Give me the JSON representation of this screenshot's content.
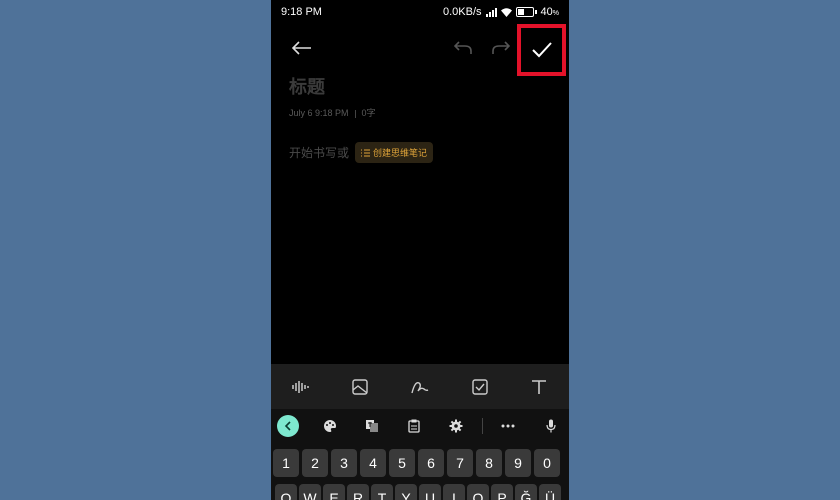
{
  "status": {
    "time": "9:18 PM",
    "network_speed": "0.0KB/s",
    "battery_percent": "40",
    "battery_unit": "%"
  },
  "editor": {
    "title_placeholder": "标题",
    "date": "July 6 9:18 PM",
    "word_count": "0字",
    "body_placeholder": "开始书写或",
    "mindmap_button": "创建思维笔记"
  },
  "toolbar_icons": [
    "back-arrow",
    "undo",
    "redo",
    "checkmark"
  ],
  "format_icons": [
    "voice-wave",
    "image",
    "handwriting",
    "checkbox",
    "text-format"
  ],
  "keyboard": {
    "number_row": [
      "1",
      "2",
      "3",
      "4",
      "5",
      "6",
      "7",
      "8",
      "9",
      "0"
    ],
    "letter_row": [
      "Q",
      "W",
      "E",
      "R",
      "T",
      "Y",
      "U",
      "I",
      "O",
      "P",
      "Ğ",
      "Ü"
    ],
    "tool_icons": [
      "collapse",
      "palette",
      "translate",
      "clipboard",
      "settings",
      "more",
      "mic"
    ]
  },
  "colors": {
    "highlight": "#e3122a",
    "accent": "#e0a53a",
    "keyboard_collapse": "#7ee8cf"
  }
}
